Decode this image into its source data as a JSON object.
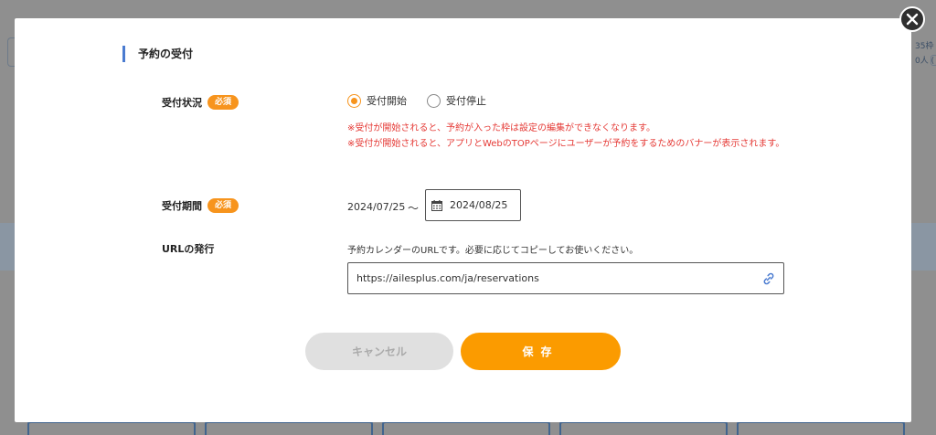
{
  "background": {
    "right_text_line1": "35枠",
    "right_text_line2": "0人 ("
  },
  "modal": {
    "section_title": "予約の受付",
    "status": {
      "label": "受付状況",
      "required_badge": "必須",
      "options": [
        {
          "label": "受付開始",
          "selected": true
        },
        {
          "label": "受付停止",
          "selected": false
        }
      ],
      "warning_line1": "※受付が開始されると、予約が入った枠は設定の編集ができなくなります。",
      "warning_line2": "※受付が開始されると、アプリとWebのTOPページにユーザーが予約をするためのバナーが表示されます。"
    },
    "period": {
      "label": "受付期間",
      "required_badge": "必須",
      "start_date": "2024/07/25",
      "separator": "～",
      "end_date": "2024/08/25"
    },
    "url": {
      "label": "URLの発行",
      "hint": "予約カレンダーのURLです。必要に応じてコピーしてお使いください。",
      "value": "https://ailesplus.com/ja/reservations"
    },
    "buttons": {
      "cancel": "キャンセル",
      "save": "保存"
    }
  },
  "colors": {
    "accent": "#fb9b00",
    "required_badge": "#f7941d",
    "warning": "#e53935",
    "section_bar": "#4a7bd0",
    "link_icon": "#4a7bd0"
  },
  "icons": [
    "close-icon",
    "calendar-icon",
    "link-icon"
  ]
}
